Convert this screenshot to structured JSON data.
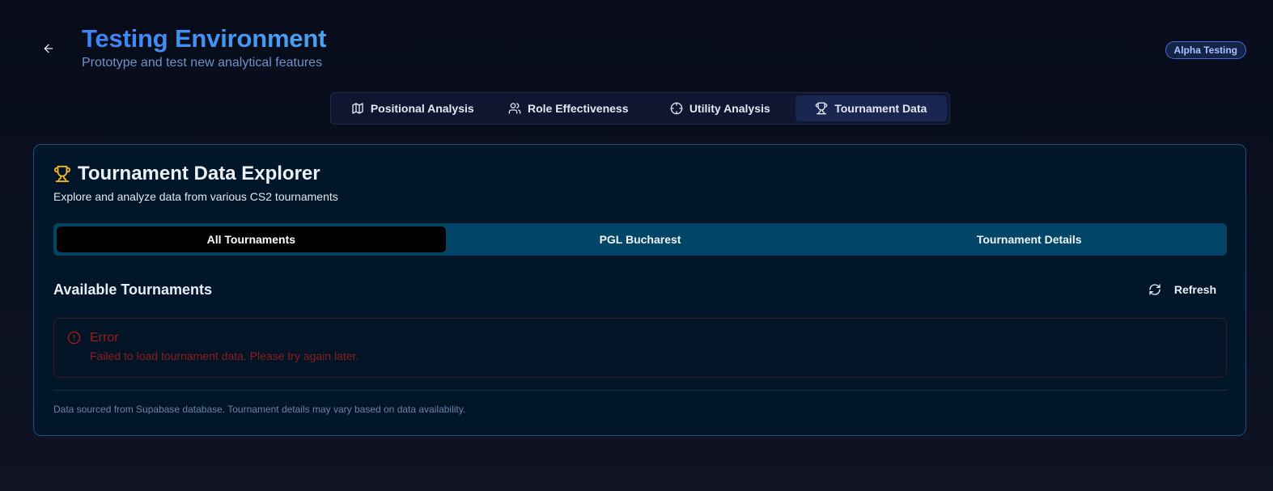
{
  "header": {
    "title": "Testing Environment",
    "subtitle": "Prototype and test new analytical features",
    "badge": "Alpha Testing",
    "back_icon": "arrow-left-icon"
  },
  "tabs": [
    {
      "label": "Positional Analysis",
      "icon": "map-icon",
      "active": false
    },
    {
      "label": "Role Effectiveness",
      "icon": "users-icon",
      "active": false
    },
    {
      "label": "Utility Analysis",
      "icon": "crosshair-icon",
      "active": false
    },
    {
      "label": "Tournament Data",
      "icon": "trophy-icon",
      "active": true
    }
  ],
  "card": {
    "title": "Tournament Data Explorer",
    "description": "Explore and analyze data from various CS2 tournaments",
    "subtabs": [
      {
        "label": "All Tournaments",
        "active": true
      },
      {
        "label": "PGL Bucharest",
        "active": false
      },
      {
        "label": "Tournament Details",
        "active": false
      }
    ],
    "section_title": "Available Tournaments",
    "refresh_label": "Refresh",
    "error": {
      "title": "Error",
      "message": "Failed to load tournament data. Please try again later."
    },
    "footnote": "Data sourced from Supabase database. Tournament details may vary based on data availability."
  },
  "colors": {
    "accent": "#3b82f6",
    "trophy": "#f5b820",
    "error": "#9b1c1c",
    "card_bg": "#011628",
    "subtab_bg": "#034566"
  }
}
